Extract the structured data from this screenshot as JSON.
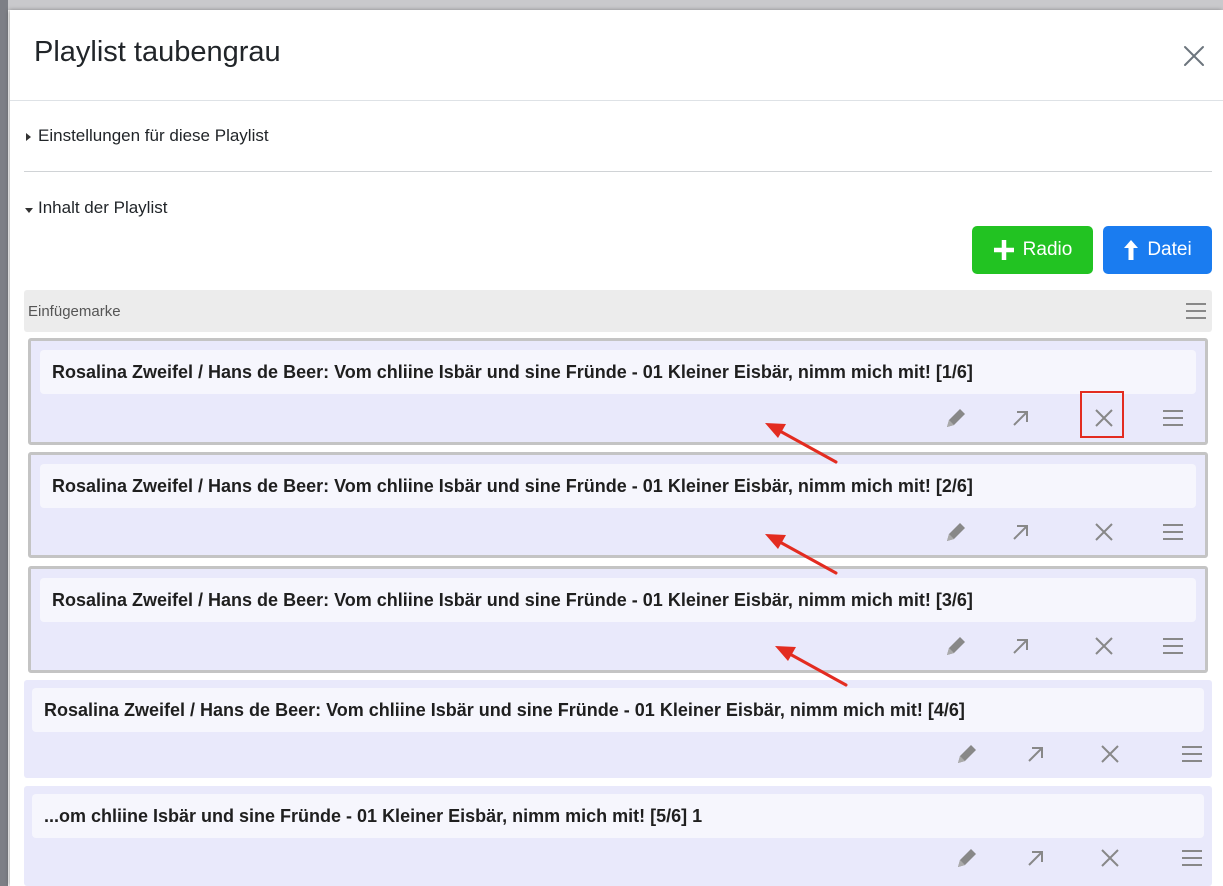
{
  "dialog": {
    "title": "Playlist taubengrau"
  },
  "sections": {
    "settings_label": "Einstellungen für diese Playlist",
    "content_label": "Inhalt der Playlist"
  },
  "buttons": {
    "radio_label": "Radio",
    "file_label": "Datei"
  },
  "insert_marker": {
    "label": "Einfügemarke"
  },
  "tracks": [
    {
      "title": "Rosalina Zweifel / Hans de Beer: Vom chliine Isbär und sine Fründe - 01 Kleiner Eisbär, nimm mich mit! [1/6]"
    },
    {
      "title": "Rosalina Zweifel / Hans de Beer: Vom chliine Isbär und sine Fründe - 01 Kleiner Eisbär, nimm mich mit! [2/6]"
    },
    {
      "title": "Rosalina Zweifel / Hans de Beer: Vom chliine Isbär und sine Fründe - 01 Kleiner Eisbär, nimm mich mit! [3/6]"
    },
    {
      "title": "Rosalina Zweifel / Hans de Beer: Vom chliine Isbär und sine Fründe - 01 Kleiner Eisbär, nimm mich mit! [4/6]"
    },
    {
      "title": "...om chliine Isbär und sine Fründe - 01 Kleiner Eisbär, nimm mich mit! [5/6]  1"
    }
  ],
  "icons": {
    "close": "close-icon",
    "caret_right": "caret-right-icon",
    "caret_down": "caret-down-icon",
    "plus": "plus-icon",
    "upload": "arrow-up-icon",
    "drag": "drag-handle-icon",
    "edit": "pencil-icon",
    "move": "arrow-up-right-icon",
    "remove": "x-icon"
  },
  "colors": {
    "radio_button": "#22c322",
    "file_button": "#1a7cf0",
    "track_background": "#e9e9fb",
    "annotation": "#e32c20"
  }
}
